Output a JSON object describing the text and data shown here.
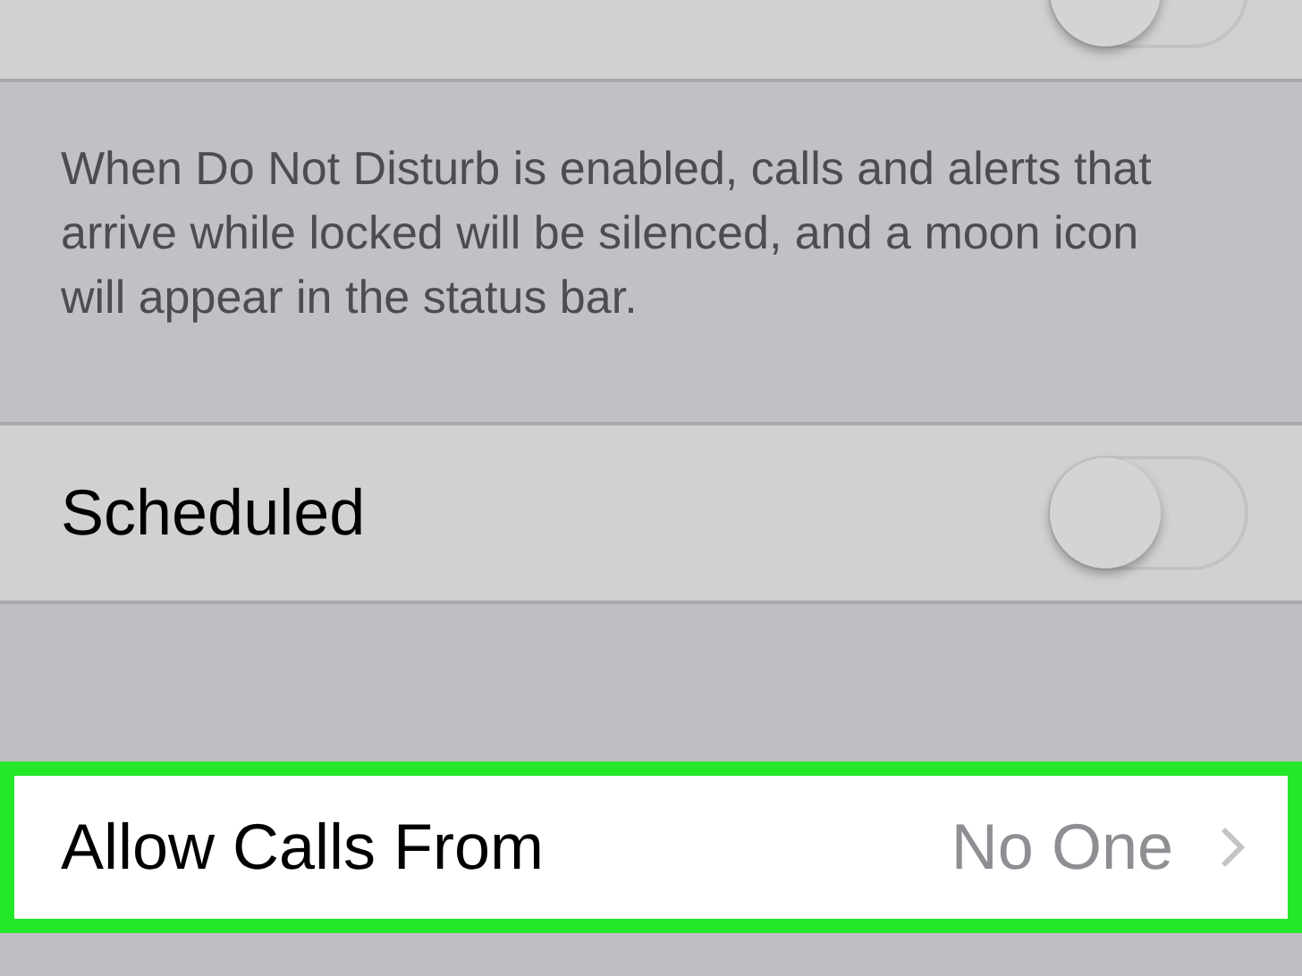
{
  "settings": [
    {
      "kind": "toggle",
      "on": false
    },
    {
      "kind": "footer",
      "text": "When Do Not Disturb is enabled, calls and alerts that arrive while locked will be silenced, and a moon icon will appear in the status bar."
    },
    {
      "kind": "toggle",
      "label": "Scheduled",
      "on": false
    },
    {
      "kind": "spacer"
    },
    {
      "kind": "link",
      "label": "Allow Calls From",
      "value": "No One",
      "highlighted": true
    }
  ]
}
